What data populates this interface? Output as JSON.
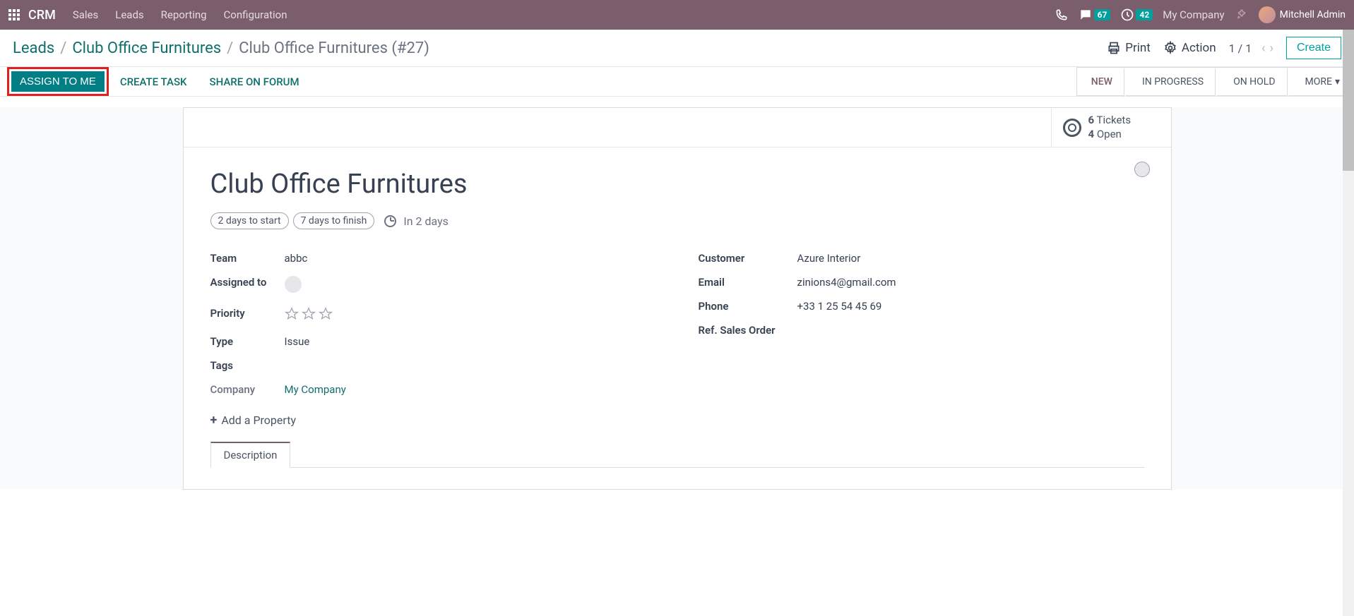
{
  "topnav": {
    "brand": "CRM",
    "items": [
      "Sales",
      "Leads",
      "Reporting",
      "Configuration"
    ],
    "msg_badge": "67",
    "activity_badge": "42",
    "company": "My Company",
    "user": "Mitchell Admin"
  },
  "breadcrumb": {
    "root": "Leads",
    "parent": "Club Office Furnitures",
    "current": "Club Office Furnitures (#27)",
    "print": "Print",
    "action": "Action",
    "pager": "1 / 1",
    "create": "Create"
  },
  "actions": {
    "assign": "ASSIGN TO ME",
    "create_task": "CREATE TASK",
    "share": "SHARE ON FORUM"
  },
  "stages": {
    "s1": "NEW",
    "s2": "IN PROGRESS",
    "s3": "ON HOLD",
    "more": "MORE"
  },
  "stat": {
    "tickets_n": "6",
    "tickets_l": "Tickets",
    "open_n": "4",
    "open_l": "Open"
  },
  "record": {
    "title": "Club Office Furnitures",
    "pill1": "2 days to start",
    "pill2": "7 days to finish",
    "in_days": "In 2 days"
  },
  "left": {
    "team_l": "Team",
    "team_v": "abbc",
    "assigned_l": "Assigned to",
    "priority_l": "Priority",
    "type_l": "Type",
    "type_v": "Issue",
    "tags_l": "Tags",
    "company_l": "Company",
    "company_v": "My Company"
  },
  "right": {
    "customer_l": "Customer",
    "customer_v": "Azure Interior",
    "email_l": "Email",
    "email_v": "zinions4@gmail.com",
    "phone_l": "Phone",
    "phone_v": "+33 1 25 54 45 69",
    "ref_l": "Ref. Sales Order"
  },
  "add_property": "Add a Property",
  "tab_description": "Description"
}
